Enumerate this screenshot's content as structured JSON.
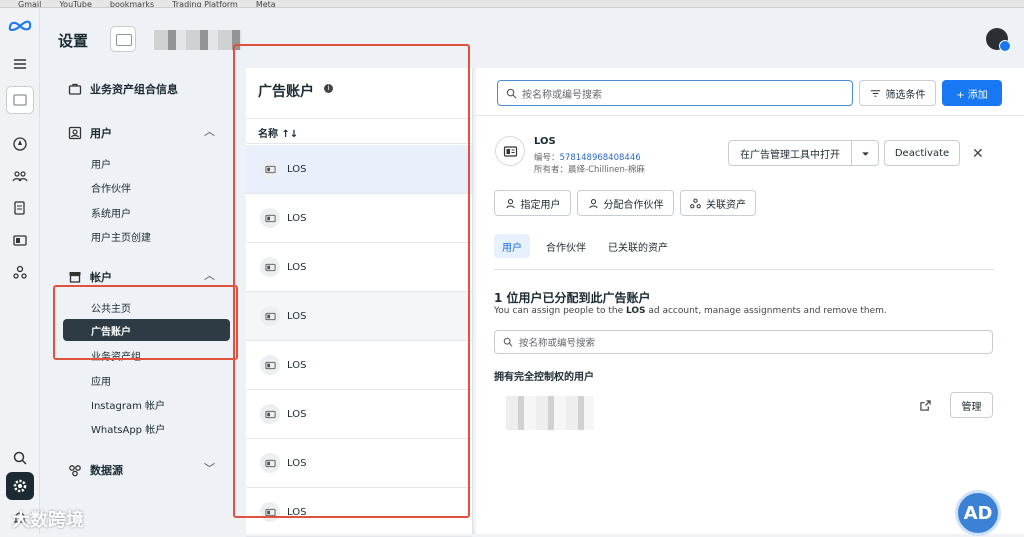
{
  "header": {
    "title": "设置"
  },
  "nav": {
    "business_info": "业务资产组合信息",
    "users_section": "用户",
    "users_items": [
      "用户",
      "合作伙伴",
      "系统用户",
      "用户主页创建"
    ],
    "accounts_section": "帐户",
    "accounts_items": [
      "公共主页",
      "广告账户",
      "业务资产组",
      "应用",
      "Instagram 帐户",
      "WhatsApp 帐户"
    ],
    "data_sources_section": "数据源"
  },
  "list": {
    "title": "广告账户",
    "column_name": "名称 ↑↓",
    "rows": [
      "LOS",
      "LOS",
      "LOS",
      "LOS",
      "LOS",
      "LOS",
      "LOS",
      "LOS"
    ]
  },
  "detail": {
    "search_placeholder": "按名称或编号搜索",
    "filter_label": "筛选条件",
    "add_label": "+ 添加",
    "account_name": "LOS",
    "id_prefix": "编号：",
    "id_value": "578148968408446",
    "owner": "所有者：晨绎-Chillinen-棉麻",
    "open_in_ads_manager": "在广告管理工具中打开",
    "deactivate": "Deactivate",
    "assign_user": "指定用户",
    "assign_partner": "分配合作伙伴",
    "linked_assets": "关联资产",
    "tabs": [
      "用户",
      "合作伙伴",
      "已关联的资产"
    ],
    "assigned_heading": "1 位用户已分配到此广告账户",
    "desc_pre": "You can assign people to the ",
    "desc_bold": "LOS",
    "desc_post": " ad account, manage assignments and remove them.",
    "search2_placeholder": "按名称或编号搜索",
    "subheading": "拥有完全控制权的用户",
    "manage": "管理"
  },
  "watermark": "大数跨境",
  "accent_color": "#1877f2"
}
